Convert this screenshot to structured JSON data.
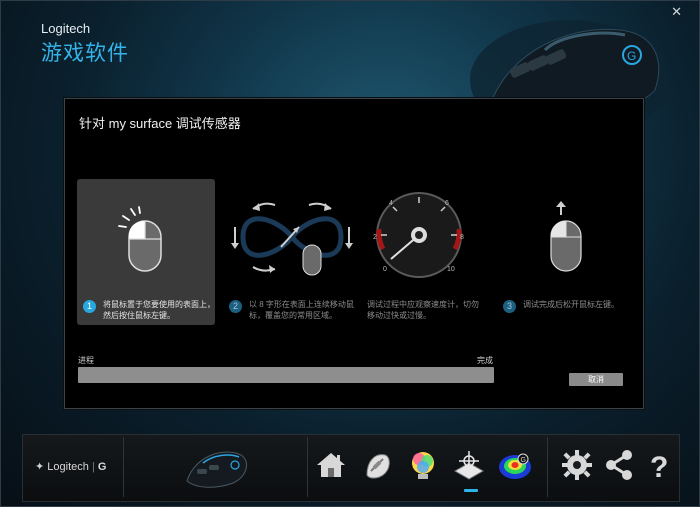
{
  "window": {
    "brand_en": "Logitech",
    "brand_cn": "游戏软件",
    "close_glyph": "✕"
  },
  "panel": {
    "title": "针对 my surface 调试传感器",
    "steps": [
      {
        "number": "1",
        "text": "将鼠标置于您要使用的表面上，然后按住鼠标左键。",
        "active": true
      },
      {
        "number": "2",
        "text": "以 8 字形在表面上连续移动鼠标，覆盖您的常用区域。",
        "active": false
      },
      {
        "number": "",
        "text": "调试过程中应观察速度计，切勿移动过快或过慢。",
        "active": false
      },
      {
        "number": "3",
        "text": "调试完成后松开鼠标左键。",
        "active": false
      }
    ],
    "gauge_ticks": [
      "0",
      "2",
      "4",
      "6",
      "8",
      "10"
    ],
    "progress_label": "进程",
    "complete_label": "完成",
    "progress_value": 0,
    "cancel_label": "取消"
  },
  "footer": {
    "logo_text": "Logitech",
    "logo_mark": "G",
    "icons": [
      "device-mouse-icon",
      "home-icon",
      "customize-buttons-icon",
      "lighting-icon",
      "surface-tuning-icon",
      "heatmap-icon",
      "settings-gear-icon",
      "share-icon",
      "help-question-icon"
    ],
    "selected": "surface-tuning-icon"
  },
  "colors": {
    "accent": "#29a8e0",
    "panel_bg": "#000000",
    "progress_bar": "#8e8e8e"
  }
}
